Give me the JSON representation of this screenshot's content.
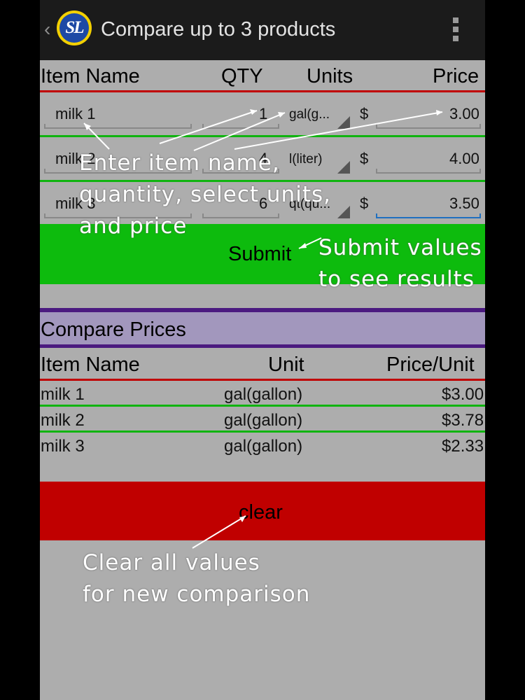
{
  "app": {
    "title": "Compare up to 3 products",
    "back_glyph": "‹",
    "logo_text": "SL"
  },
  "input_table": {
    "headers": {
      "item_name": "Item Name",
      "qty": "QTY",
      "units": "Units",
      "price": "Price"
    },
    "currency_symbol": "$",
    "rows": [
      {
        "name": "milk 1",
        "qty": "1",
        "unit": "gal(g...",
        "price": "3.00"
      },
      {
        "name": "milk 2",
        "qty": "4",
        "unit": "l(liter)",
        "price": "4.00"
      },
      {
        "name": "milk 3",
        "qty": "6",
        "unit": "qt(qu...",
        "price": "3.50"
      }
    ]
  },
  "submit": {
    "label": "Submit"
  },
  "results": {
    "title": "Compare Prices",
    "headers": {
      "item_name": "Item Name",
      "unit": "Unit",
      "price_per_unit": "Price/Unit"
    },
    "rows": [
      {
        "name": "milk 1",
        "unit": "gal(gallon)",
        "price": "$3.00"
      },
      {
        "name": "milk 2",
        "unit": "gal(gallon)",
        "price": "$3.78"
      },
      {
        "name": "milk 3",
        "unit": "gal(gallon)",
        "price": "$2.33"
      }
    ]
  },
  "clear": {
    "label": "clear"
  },
  "annotations": {
    "enter_line1": "Enter item name,",
    "enter_line2": "quantity, select units,",
    "enter_line3": "and price",
    "submit_line1": "Submit values",
    "submit_line2": "to see results",
    "clear_line1": "Clear all values",
    "clear_line2": "for new comparison"
  },
  "colors": {
    "action_bar": "#1b1b1b",
    "background": "#adadad",
    "submit_button": "#0dbb0d",
    "clear_button": "#c00000",
    "compare_header": "#a297bd",
    "divider_red": "#c00000",
    "divider_green": "#10b410"
  }
}
